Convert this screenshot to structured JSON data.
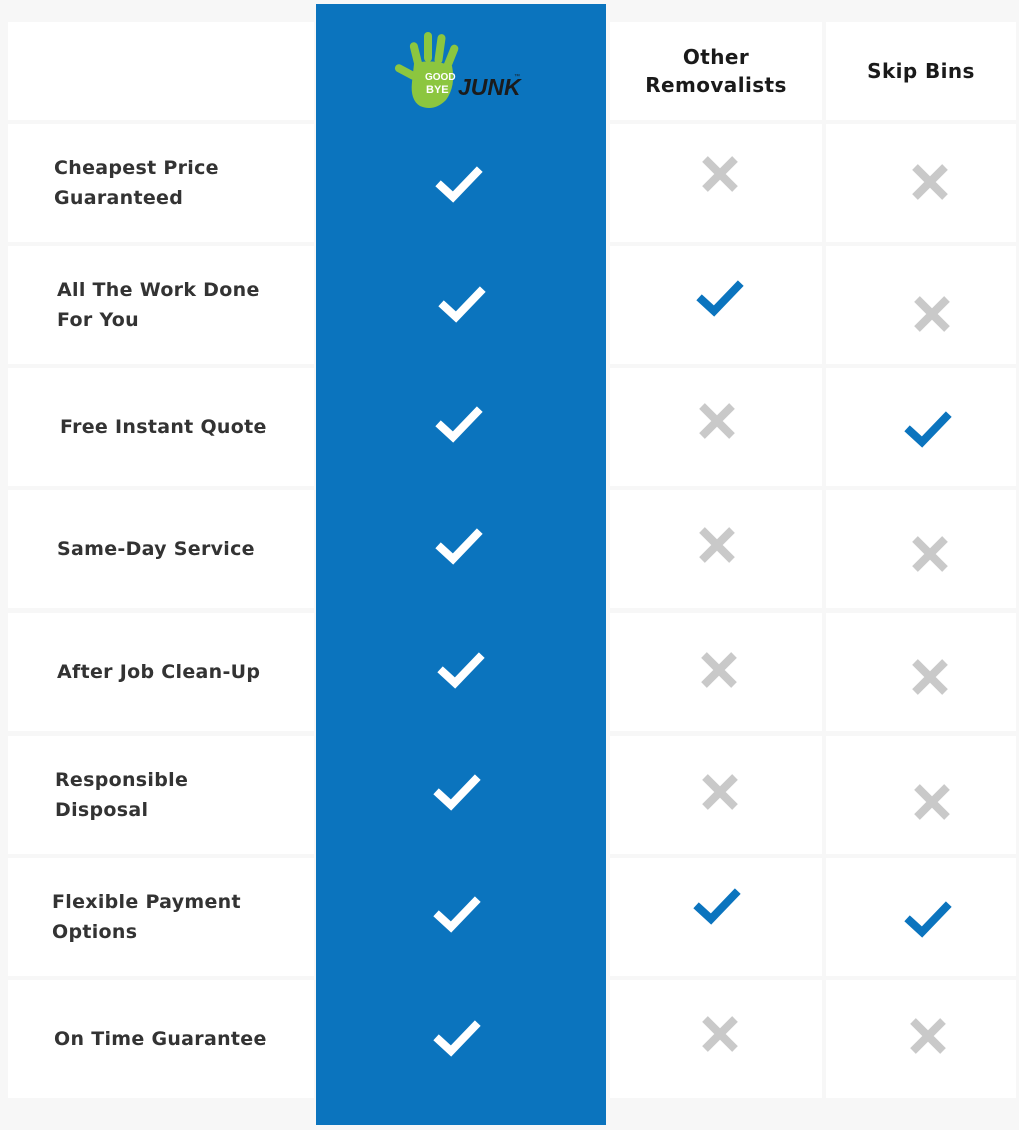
{
  "columns": {
    "brand_logo_text_top": "GOOD",
    "brand_logo_text_mid": "BYE",
    "brand_logo_text_word": "JUNK",
    "brand_logo_tm": "™",
    "other_removalists": "Other Removalists",
    "skip_bins": "Skip Bins"
  },
  "rows": [
    {
      "feature": "Cheapest Price Guaranteed",
      "goodbye_junk": "check",
      "other_removalists": "cross",
      "skip_bins": "cross"
    },
    {
      "feature": "All The Work Done For You",
      "goodbye_junk": "check",
      "other_removalists": "check",
      "skip_bins": "cross"
    },
    {
      "feature": "Free Instant Quote",
      "goodbye_junk": "check",
      "other_removalists": "cross",
      "skip_bins": "check"
    },
    {
      "feature": "Same-Day Service",
      "goodbye_junk": "check",
      "other_removalists": "cross",
      "skip_bins": "cross"
    },
    {
      "feature": "After Job Clean-Up",
      "goodbye_junk": "check",
      "other_removalists": "cross",
      "skip_bins": "cross"
    },
    {
      "feature": "Responsible Disposal",
      "goodbye_junk": "check",
      "other_removalists": "cross",
      "skip_bins": "cross"
    },
    {
      "feature": "Flexible Payment Options",
      "goodbye_junk": "check",
      "other_removalists": "check",
      "skip_bins": "check"
    },
    {
      "feature": "On Time Guarantee",
      "goodbye_junk": "check",
      "other_removalists": "cross",
      "skip_bins": "cross"
    }
  ],
  "colors": {
    "brand_column": "#0b74be",
    "check_on_brand": "#ffffff",
    "check_competitor": "#0b74be",
    "cross": "#c9c9c9",
    "logo_green": "#8cc63f"
  },
  "icons": {
    "check": "check-icon",
    "cross": "cross-icon",
    "logo": "goodbye-junk-hand-logo"
  }
}
